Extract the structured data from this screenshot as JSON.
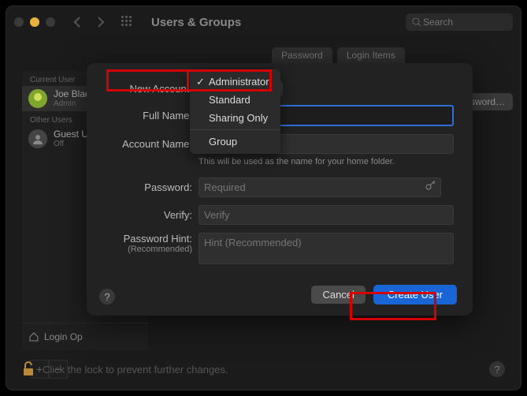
{
  "window": {
    "title": "Users & Groups",
    "search_placeholder": "Search"
  },
  "tabs": {
    "password": "Password",
    "login_items": "Login Items"
  },
  "sidebar": {
    "current_hdr": "Current User",
    "other_hdr": "Other Users",
    "current": {
      "name": "Joe Black",
      "role": "Admin"
    },
    "other": {
      "name": "Guest U",
      "role": "Off"
    },
    "login_options": "Login Op"
  },
  "change_password": "Change Password…",
  "sheet": {
    "new_account_label": "New Account:",
    "full_name_label": "Full Name:",
    "account_name_label": "Account Name:",
    "account_name_hint": "This will be used as the name for your home folder.",
    "password_label": "Password:",
    "password_placeholder": "Required",
    "verify_label": "Verify:",
    "verify_placeholder": "Verify",
    "hint_label": "Password Hint:",
    "hint_sub": "(Recommended)",
    "hint_placeholder": "Hint (Recommended)",
    "cancel": "Cancel",
    "create_user": "Create User"
  },
  "dropdown": {
    "options": [
      "Administrator",
      "Standard",
      "Sharing Only",
      "Group"
    ],
    "selected": "Administrator"
  },
  "lock_text": "Click the lock to prevent further changes."
}
